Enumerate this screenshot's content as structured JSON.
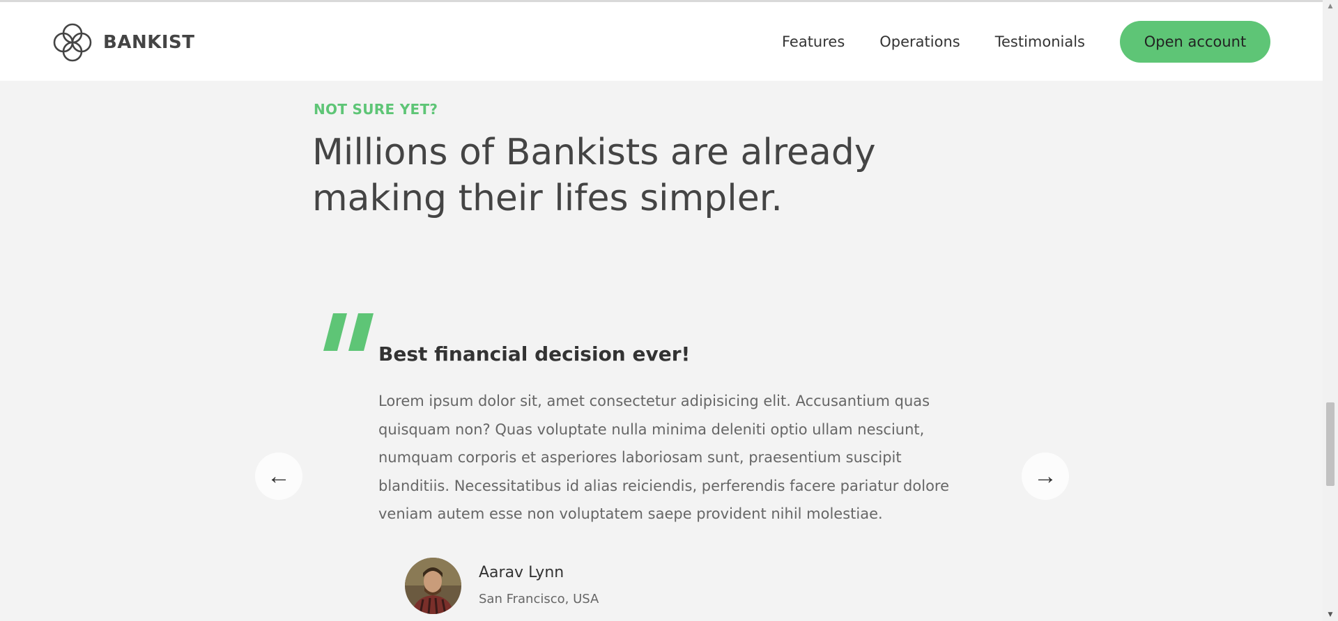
{
  "header": {
    "logo_text": "BANKIST",
    "logo_icon": "bankist-logo-icon",
    "nav": [
      {
        "label": "Features"
      },
      {
        "label": "Operations"
      },
      {
        "label": "Testimonials"
      }
    ],
    "cta_label": "Open account"
  },
  "section": {
    "eyebrow": "NOT SURE YET?",
    "headline": "Millions of Bankists are already making their lifes simpler."
  },
  "testimonial": {
    "title": "Best financial decision ever!",
    "body": "Lorem ipsum dolor sit, amet consectetur adipisicing elit. Accusantium quas quisquam non? Quas voluptate nulla minima deleniti optio ullam nesciunt, numquam corporis et asperiores laboriosam sunt, praesentium suscipit blanditiis. Necessitatibus id alias reiciendis, perferendis facere pariatur dolore veniam autem esse non voluptatem saepe provident nihil molestiae.",
    "author_name": "Aarav Lynn",
    "author_location": "San Francisco, USA",
    "avatar_icon": "author-avatar"
  },
  "slider": {
    "prev_glyph": "←",
    "next_glyph": "→"
  },
  "colors": {
    "accent": "#5ec576",
    "background": "#f3f3f3",
    "header_bg": "#ffffff",
    "text_dark": "#444444",
    "text_body": "#666666"
  }
}
